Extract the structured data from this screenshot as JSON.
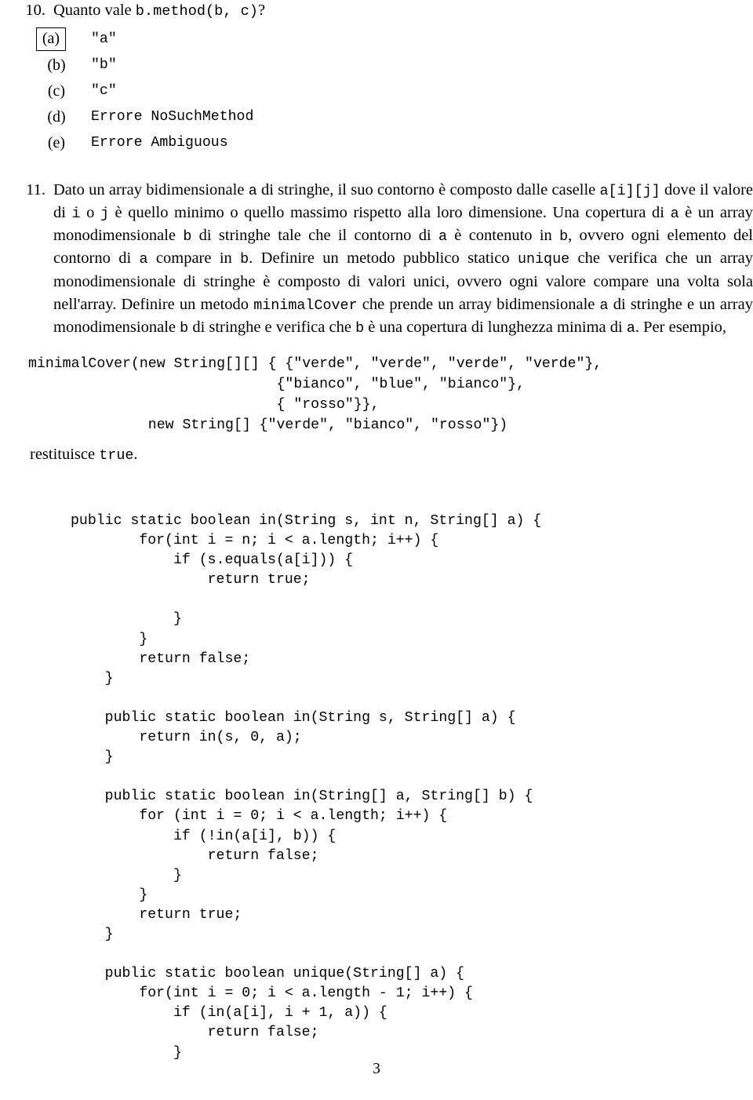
{
  "document": {
    "page_number": "3"
  },
  "question10": {
    "number": "10.",
    "prompt_prefix": "Quanto vale ",
    "prompt_code": "b.method(b, c)",
    "prompt_suffix": "?",
    "options": [
      {
        "label": "(a)",
        "text": "\"a\"",
        "boxed": true
      },
      {
        "label": "(b)",
        "text": "\"b\"",
        "boxed": false
      },
      {
        "label": "(c)",
        "text": "\"c\"",
        "boxed": false
      },
      {
        "label": "(d)",
        "text": "Errore NoSuchMethod",
        "boxed": false
      },
      {
        "label": "(e)",
        "text": "Errore Ambiguous",
        "boxed": false
      }
    ]
  },
  "question11": {
    "number": "11.",
    "paragraph": {
      "t1": "Dato un array bidimensionale ",
      "c1": "a",
      "t2": " di stringhe, il suo contorno è composto dalle caselle ",
      "c2": "a[i][j]",
      "t3": " dove il valore di ",
      "c3": "i",
      "t4": " o ",
      "c4": "j",
      "t5": " è quello minimo o quello massimo rispetto alla loro dimensione. Una copertura di ",
      "c5": "a",
      "t6": " è un array monodimensionale ",
      "c6": "b",
      "t7": " di stringhe tale che il contorno di ",
      "c7": "a",
      "t8": " è contenuto in ",
      "c8": "b",
      "t9": ", ovvero ogni elemento del contorno di ",
      "c9": "a",
      "t10": " compare in ",
      "c10": "b",
      "t11": ". Definire un metodo pubblico statico ",
      "c11": "unique",
      "t12": " che verifica che un array monodimensionale di stringhe è composto di valori unici, ovvero ogni valore compare una volta sola nell'array. Definire un metodo ",
      "c12": "minimalCover",
      "t13": " che prende un array bidimensionale ",
      "c13": "a",
      "t14": " di stringhe e un array monodimensionale ",
      "c14": "b",
      "t15": " di stringhe e verifica che ",
      "c15": "b",
      "t16": " è una copertura di lunghezza minima di ",
      "c16": "a",
      "t17": ". Per esempio,"
    },
    "example_code": "minimalCover(new String[][] { {\"verde\", \"verde\", \"verde\", \"verde\"},\n                             {\"bianco\", \"blue\", \"bianco\"},\n                             { \"rosso\"}},\n              new String[] {\"verde\", \"bianco\", \"rosso\"})",
    "result_text": "restituisce ",
    "result_code": "true",
    "result_suffix": ".",
    "listing": "public static boolean in(String s, int n, String[] a) {\n        for(int i = n; i < a.length; i++) {\n            if (s.equals(a[i])) {\n                return true;\n\n            }\n        }\n        return false;\n    }\n\n    public static boolean in(String s, String[] a) {\n        return in(s, 0, a);\n    }\n\n    public static boolean in(String[] a, String[] b) {\n        for (int i = 0; i < a.length; i++) {\n            if (!in(a[i], b)) {\n                return false;\n            }\n        }\n        return true;\n    }\n\n    public static boolean unique(String[] a) {\n        for(int i = 0; i < a.length - 1; i++) {\n            if (in(a[i], i + 1, a)) {\n                return false;\n            }"
  }
}
